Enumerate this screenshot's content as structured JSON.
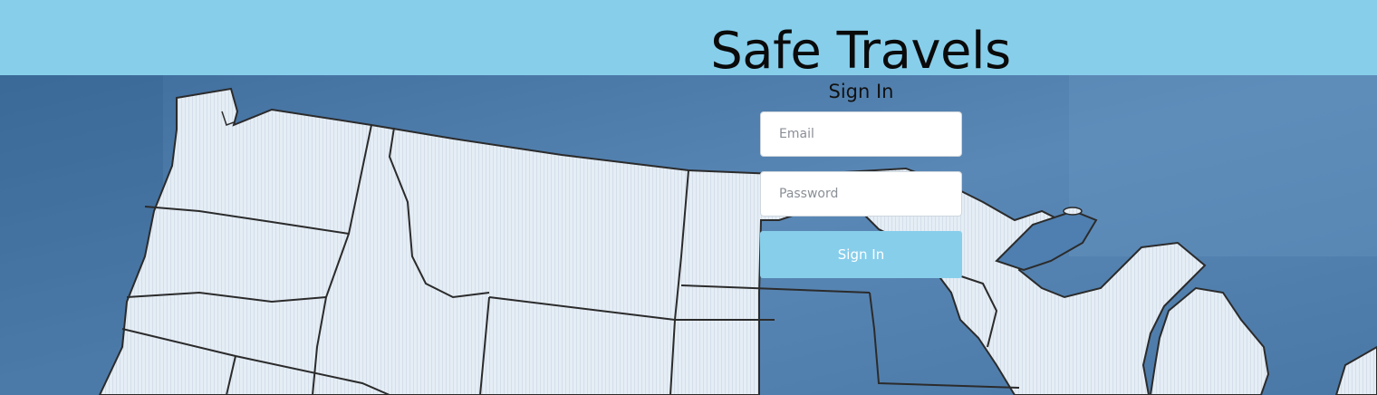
{
  "header": {
    "title": "Safe Travels"
  },
  "signin_form": {
    "heading": "Sign In",
    "email_placeholder": "Email",
    "email_value": "",
    "password_placeholder": "Password",
    "password_value": "",
    "submit_label": "Sign In"
  },
  "colors": {
    "header_bg": "#87ceeb",
    "button_bg": "#87ceeb",
    "map_ocean": "#4f7ca9",
    "map_land": "#e3ecf4"
  },
  "background": {
    "icon": "us-map-illustration"
  }
}
